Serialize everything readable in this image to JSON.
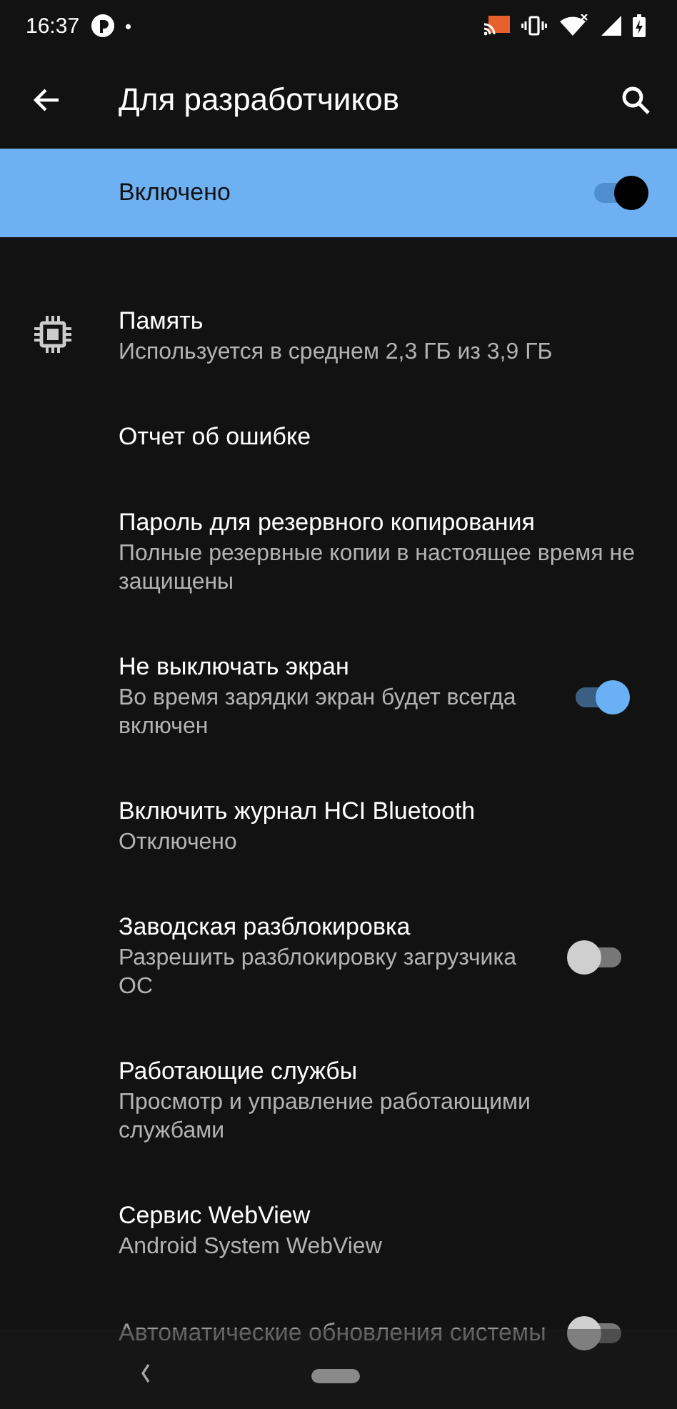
{
  "status_bar": {
    "time": "16:37",
    "dot": "•"
  },
  "app_bar": {
    "title": "Для разработчиков"
  },
  "master_switch": {
    "label": "Включено",
    "on": true
  },
  "settings": [
    {
      "kind": "icon",
      "title": "Память",
      "subtitle": "Используется в среднем 2,3 ГБ из 3,9 ГБ"
    },
    {
      "kind": "plain",
      "title": "Отчет об ошибке"
    },
    {
      "kind": "plain",
      "title": "Пароль для резервного копирования",
      "subtitle": "Полные резервные копии в настоящее время не защищены"
    },
    {
      "kind": "switch",
      "title": "Не выключать экран",
      "subtitle": "Во время зарядки экран будет всегда включен",
      "on": true
    },
    {
      "kind": "plain",
      "title": "Включить журнал HCI Bluetooth",
      "subtitle": "Отключено"
    },
    {
      "kind": "switch",
      "title": "Заводская разблокировка",
      "subtitle": "Разрешить разблокировку загрузчика ОС",
      "on": false
    },
    {
      "kind": "plain",
      "title": "Работающие службы",
      "subtitle": "Просмотр и управление работающими службами"
    },
    {
      "kind": "plain",
      "title": "Сервис WebView",
      "subtitle": "Android System WebView"
    },
    {
      "kind": "switch",
      "title": "Автоматические обновления системы",
      "on": false
    }
  ]
}
